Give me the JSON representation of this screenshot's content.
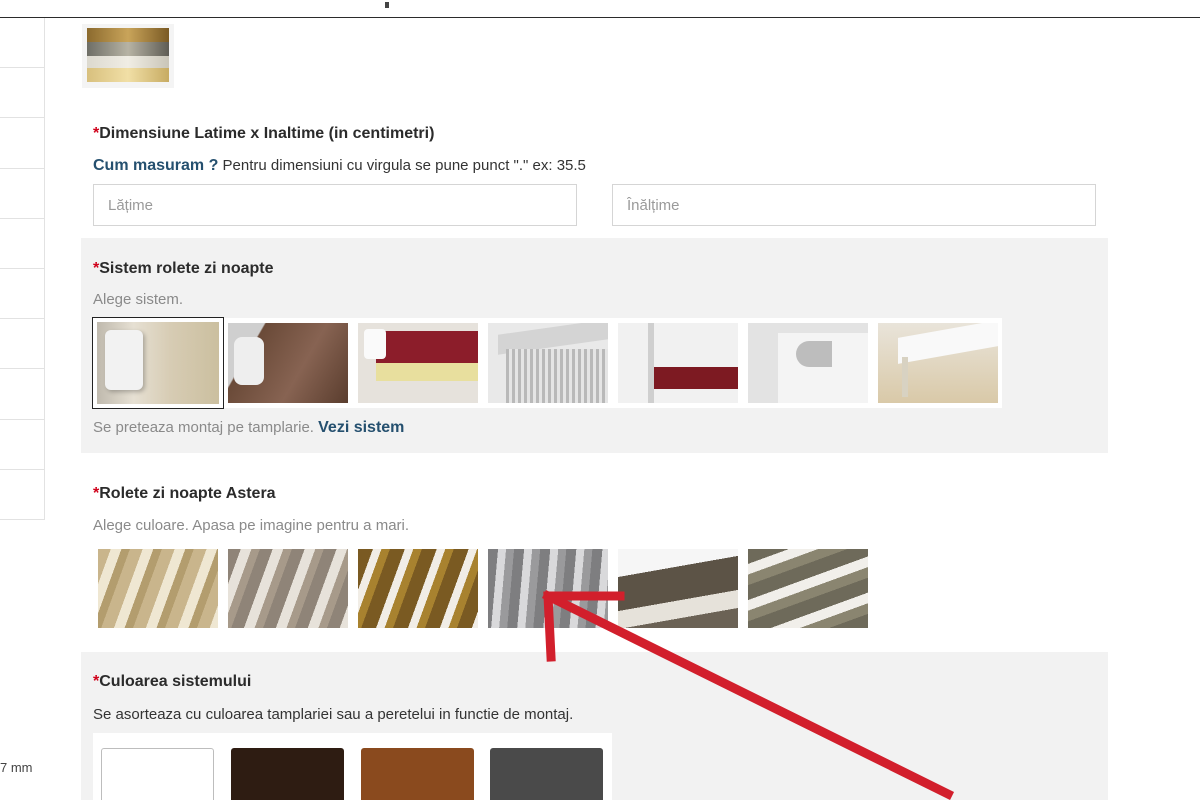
{
  "dimensions": {
    "title": "Dimensiune Latime x Inaltime (in centimetri)",
    "required": "*",
    "help_link": "Cum masuram ?",
    "help_text": " Pentru dimensiuni cu virgula se pune punct \".\" ex: 35.5",
    "width_placeholder": "Lățime",
    "height_placeholder": "Înălțime"
  },
  "system": {
    "title": "Sistem rolete zi noapte",
    "required": "*",
    "subtitle": "Alege sistem.",
    "note": "Se preteaza montaj pe tamplarie. ",
    "note_link": "Vezi sistem",
    "options": [
      "system-1",
      "system-2",
      "system-3",
      "system-4",
      "system-5",
      "system-6",
      "system-7"
    ]
  },
  "fabric": {
    "title": "Rolete zi noapte Astera",
    "required": "*",
    "subtitle": "Alege culoare. Apasa pe imagine pentru a mari.",
    "swatches": [
      "beige",
      "taupe",
      "bronze",
      "grey",
      "dark-brown",
      "olive-grey"
    ]
  },
  "system_color": {
    "title": "Culoarea sistemului",
    "required": "*",
    "subtitle": "Se asorteaza cu culoarea tamplariei sau a peretelui in functie de montaj.",
    "colors": [
      "#ffffff",
      "#2e1c12",
      "#8a4a1e",
      "#4a4a4a"
    ]
  },
  "sidebar": {
    "fragment": "7 mm"
  },
  "colors": {
    "required": "#d0021b",
    "link": "#25506f",
    "panel": "#f2f2f2",
    "arrow": "#d21f2c"
  }
}
